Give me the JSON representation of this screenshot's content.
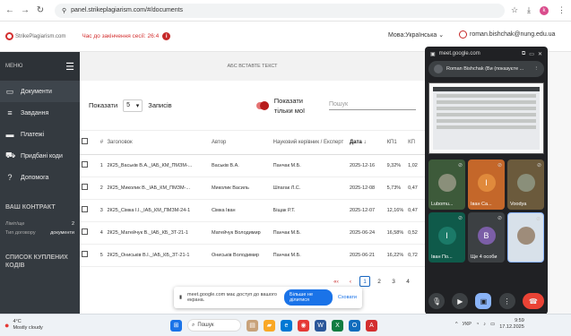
{
  "browser": {
    "url": "panel.strikeplagiarism.com/#/documents",
    "profile_initial": "k"
  },
  "app": {
    "logo_text": "StrikePlagiarism.com",
    "session_text": "Час до закінчення сесії: 26:4",
    "language": "Мова:Українська",
    "user_email": "roman.bishchak@nung.edu.ua",
    "title": "АБС ВСТАВТЕ ТЕКСТ"
  },
  "sidebar": {
    "menu_label": "МЕНЮ",
    "items": [
      {
        "label": "Документи",
        "icon": "folder-icon"
      },
      {
        "label": "Завдання",
        "icon": "list-icon"
      },
      {
        "label": "Платежі",
        "icon": "card-icon"
      },
      {
        "label": "Придбані коди",
        "icon": "cart-icon"
      },
      {
        "label": "Допомога",
        "icon": "help-icon"
      }
    ],
    "contract_heading": "ВАШ КОНТРАКТ",
    "contract_rows": [
      {
        "label": "Ліміт/ще",
        "value": "2"
      },
      {
        "label": "Тип договору",
        "value": "документи"
      }
    ],
    "codes_heading": "СПИСОК КУПЛЕНИХ КОДІВ"
  },
  "filters": {
    "show_label": "Показати",
    "page_size": "5",
    "records_label": "Записів",
    "only_mine": "Показати тільки мої",
    "search_placeholder": "Пошук"
  },
  "table": {
    "headers": [
      "#",
      "Заголовок",
      "Автор",
      "Науковий керівник / Експерт",
      "Дата",
      "КП1",
      "КП"
    ],
    "rows": [
      {
        "n": "1",
        "title": "2К25_Васьків В.А._ІАБ_КМ_ПМЗМ-...",
        "author": "Васьків В.А.",
        "supervisor": "Панчак М.Б.",
        "date": "2025-12-16",
        "kp1": "9,32%",
        "kp2": "1,02"
      },
      {
        "n": "2",
        "title": "2К25_Миколик В._ІАБ_КМ_ПМЗМ-...",
        "author": "Миколик Василь",
        "supervisor": "Шпагак Л.С.",
        "date": "2025-12-08",
        "kp1": "5,73%",
        "kp2": "0,47"
      },
      {
        "n": "3",
        "title": "2К25_Сімка І.І._ІАБ_КМ_ПМЗМ-24-1",
        "author": "Сімка Іван",
        "supervisor": "Біщак Р.Т.",
        "date": "2025-12-07",
        "kp1": "12,16%",
        "kp2": "0,47"
      },
      {
        "n": "4",
        "title": "2К25_Матейчук В._ІАБ_КБ_ЗТ-21-1",
        "author": "Матейчук Володимир",
        "supervisor": "Панчак М.Б.",
        "date": "2025-06-24",
        "kp1": "16,58%",
        "kp2": "0,52"
      },
      {
        "n": "5",
        "title": "2К25_Ониськів В.І._ІАБ_КБ_ЗТ-21-1",
        "author": "Ониськів Володимир",
        "supervisor": "Панчак М.Б.",
        "date": "2025-06-21",
        "kp1": "16,22%",
        "kp2": "0,72"
      }
    ]
  },
  "pager": [
    "«‹",
    "‹",
    "1",
    "2",
    "3",
    "4"
  ],
  "notice": {
    "text": "meet.google.com має доступ до вашого екрана.",
    "stop": "Більше не ділитися",
    "hide": "Сховати"
  },
  "meet": {
    "url": "meet.google.com",
    "presenter": "Roman Bishchak (Ви (показуєте ...",
    "tiles": [
      {
        "name": "Lubomu...",
        "color": "#3d5a3a",
        "letter": ""
      },
      {
        "name": "Іван Сa...",
        "color": "#c4672a",
        "letter": "І"
      },
      {
        "name": "Voodya",
        "color": "#6b5a3c",
        "letter": ""
      },
      {
        "name": "Іван По...",
        "color": "#0f5a4a",
        "letter": "І"
      },
      {
        "name": "Ще 4 особи",
        "color": "#3c4043",
        "letter": "В"
      },
      {
        "name": "",
        "color": "#d8e1ea",
        "letter": ""
      }
    ]
  },
  "taskbar": {
    "temp": "4°C",
    "weather": "Mostly cloudy",
    "search": "Пошук",
    "lang": "УКР",
    "time": "9:59",
    "date": "17.12.2025"
  }
}
